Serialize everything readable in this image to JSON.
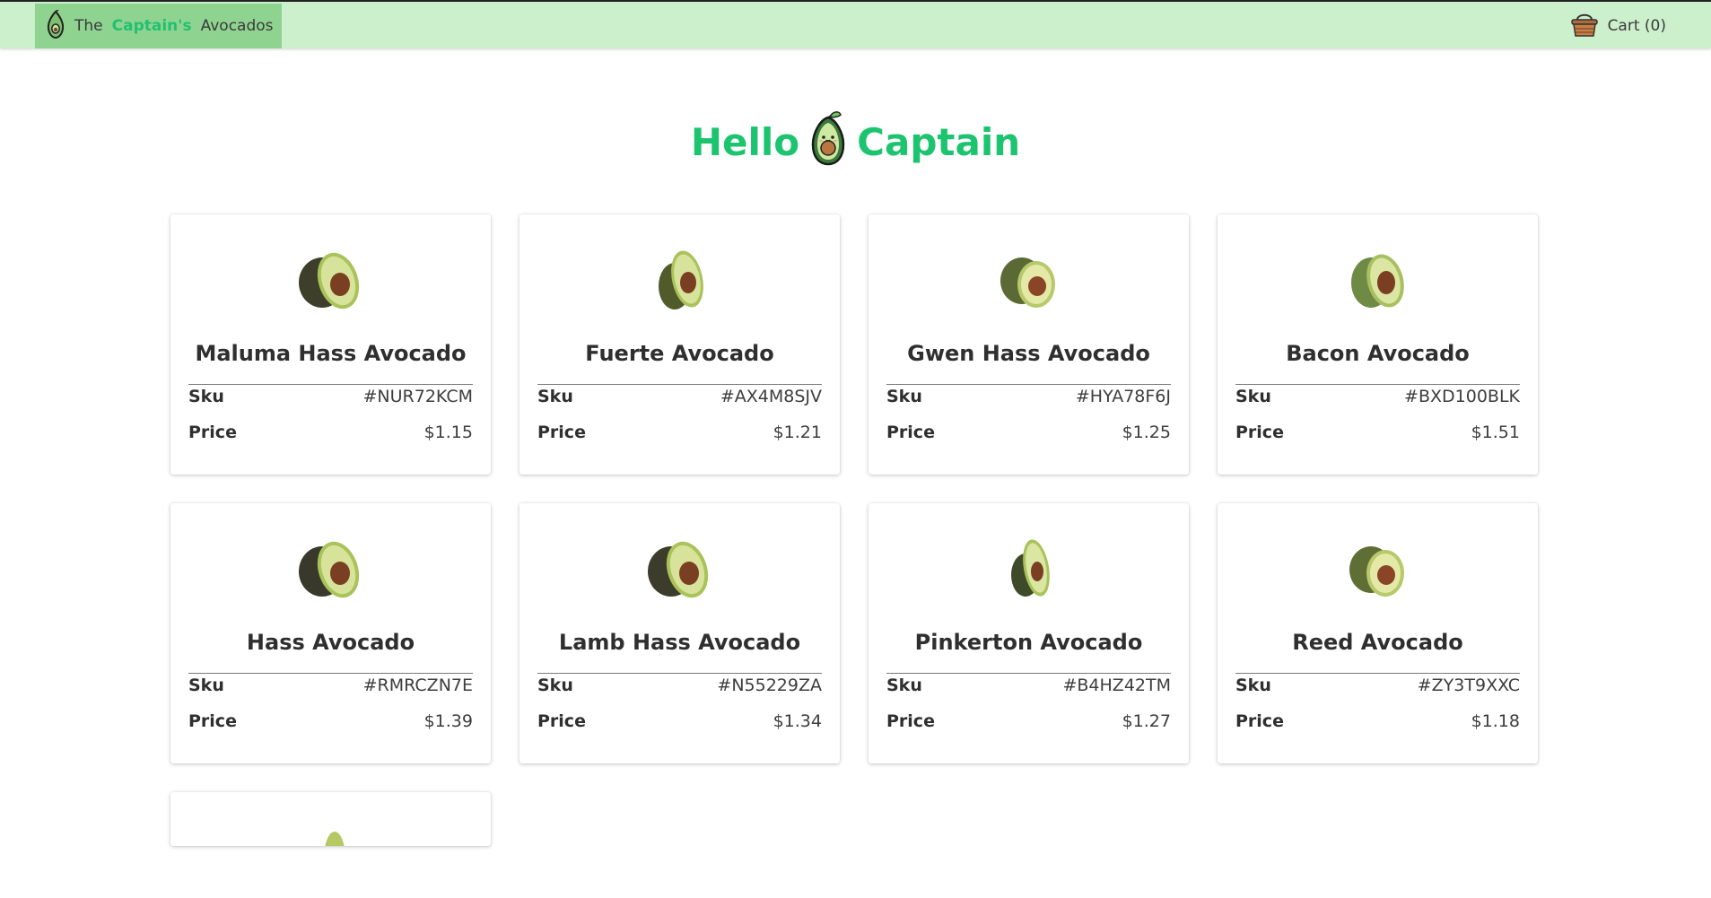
{
  "nav": {
    "brand_prefix": "The",
    "brand_highlight": "Captain's",
    "brand_suffix": "Avocados",
    "cart_label": "Cart (0)",
    "accent": "#22c072",
    "background": "#cdf0cc"
  },
  "hero": {
    "word_left": "Hello",
    "word_right": "Captain",
    "color": "#1dc46f",
    "mascot_icon": "avocado-mascot-icon"
  },
  "products": [
    {
      "name": "Maluma Hass Avocado",
      "sku_label": "Sku",
      "sku": "#NUR72KCM",
      "price_label": "Price",
      "price": "$1.15",
      "skin": "#3d3f2a"
    },
    {
      "name": "Fuerte Avocado",
      "sku_label": "Sku",
      "sku": "#AX4M8SJV",
      "price_label": "Price",
      "price": "$1.21",
      "skin": "#4f5b2a"
    },
    {
      "name": "Gwen Hass Avocado",
      "sku_label": "Sku",
      "sku": "#HYA78F6J",
      "price_label": "Price",
      "price": "$1.25",
      "skin": "#5b6a35"
    },
    {
      "name": "Bacon Avocado",
      "sku_label": "Sku",
      "sku": "#BXD100BLK",
      "price_label": "Price",
      "price": "$1.51",
      "skin": "#6f8a45"
    },
    {
      "name": "Hass Avocado",
      "sku_label": "Sku",
      "sku": "#RMRCZN7E",
      "price_label": "Price",
      "price": "$1.39",
      "skin": "#38392a"
    },
    {
      "name": "Lamb Hass Avocado",
      "sku_label": "Sku",
      "sku": "#N55229ZA",
      "price_label": "Price",
      "price": "$1.34",
      "skin": "#3b3c2b"
    },
    {
      "name": "Pinkerton Avocado",
      "sku_label": "Sku",
      "sku": "#B4HZ42TM",
      "price_label": "Price",
      "price": "$1.27",
      "skin": "#3f4a2a"
    },
    {
      "name": "Reed Avocado",
      "sku_label": "Sku",
      "sku": "#ZY3T9XXC",
      "price_label": "Price",
      "price": "$1.18",
      "skin": "#5f6e34"
    }
  ]
}
